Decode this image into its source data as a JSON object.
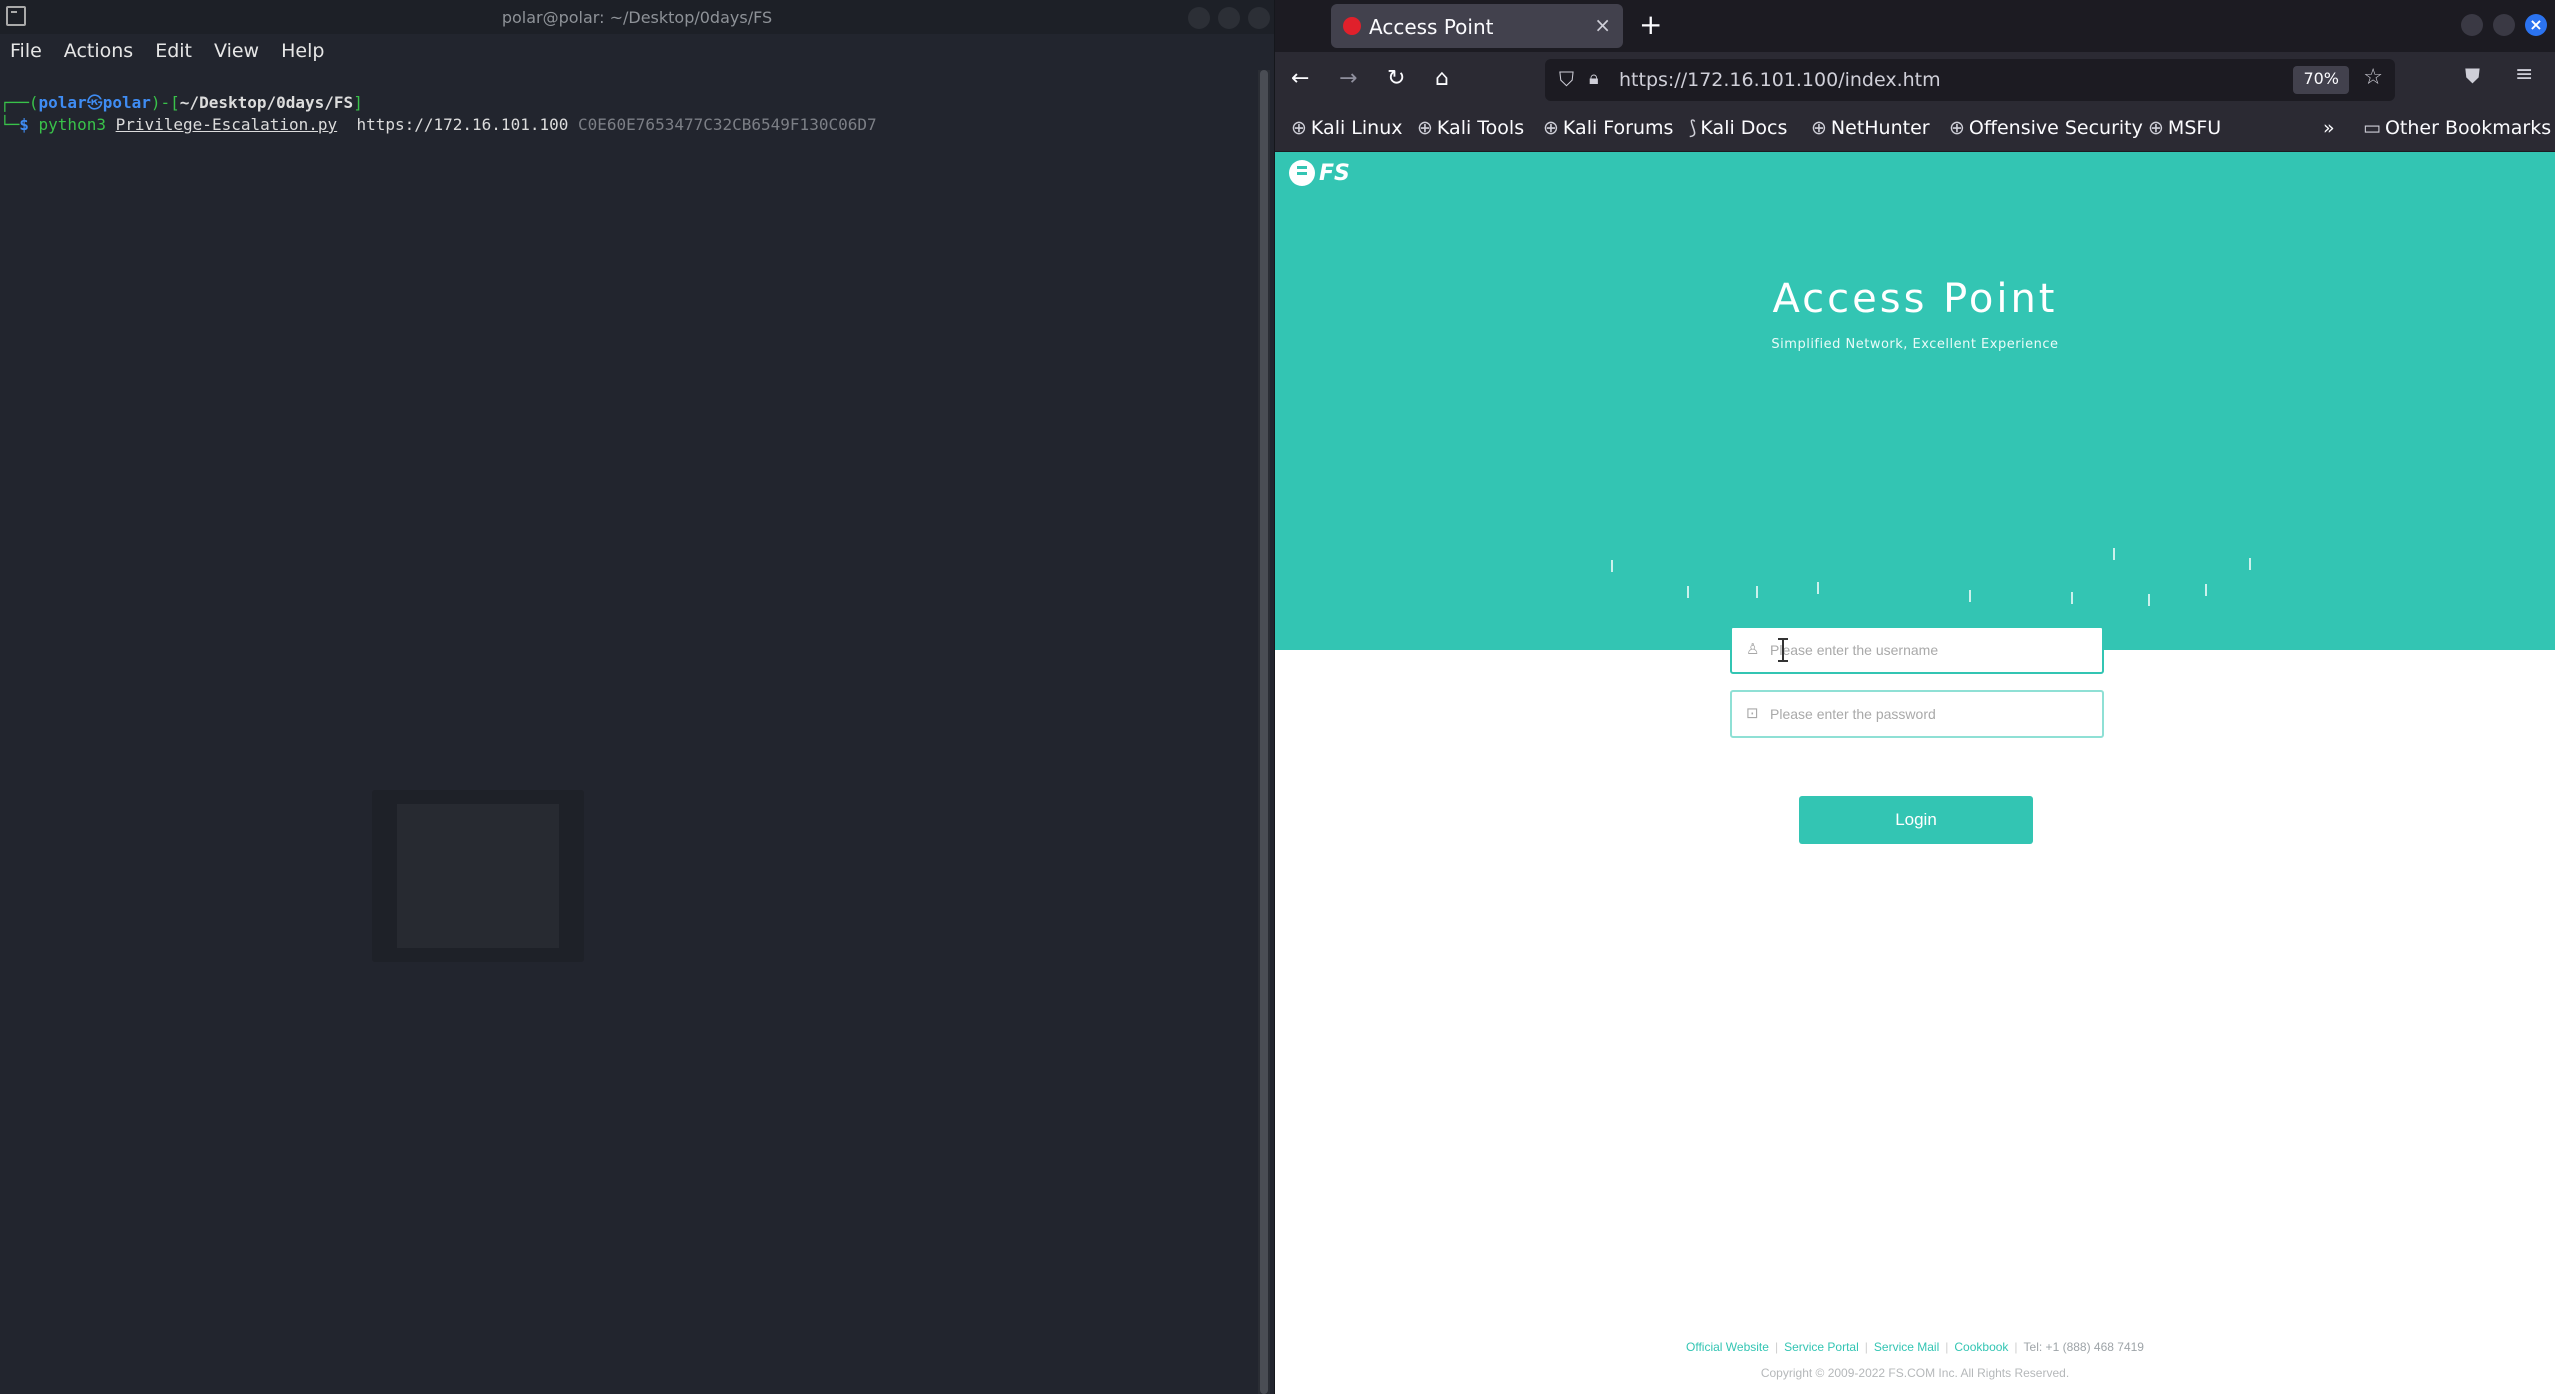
{
  "terminal": {
    "title": "polar@polar: ~/Desktop/0days/FS",
    "menu": [
      "File",
      "Actions",
      "Edit",
      "View",
      "Help"
    ],
    "prompt": {
      "corner_top": "┌──(",
      "user": "polar",
      "at": "㉿",
      "host": "polar",
      "mid": ")-[",
      "path": "~/Desktop/0days/FS",
      "end": "]",
      "corner_bottom": "└─",
      "dollar": "$ "
    },
    "command": {
      "program": "python3",
      "script": "Privilege-Escalation.py",
      "url": "https://172.16.101.100",
      "arg": "C0E60E7653477C32CB6549F130C06D7"
    }
  },
  "browser": {
    "tab": {
      "title": "Access Point",
      "close": "×"
    },
    "new_tab": "+",
    "url": "https://172.16.101.100/index.htm",
    "zoom": "70%",
    "bookmarks": [
      "Kali Linux",
      "Kali Tools",
      "Kali Forums",
      "Kali Docs",
      "NetHunter",
      "Offensive Security",
      "MSFU"
    ],
    "overflow": "»",
    "other_bookmarks": "Other Bookmarks"
  },
  "page": {
    "logo_text": "FS",
    "title": "Access Point",
    "subtitle": "Simplified Network, Excellent Experience",
    "username_placeholder": "Please enter the username",
    "password_placeholder": "Please enter the password",
    "login_label": "Login",
    "footer": {
      "links": [
        "Official Website",
        "Service Portal",
        "Service Mail",
        "Cookbook"
      ],
      "tel": "Tel: +1 (888) 468 7419",
      "copyright": "Copyright © 2009-2022 FS.COM Inc. All Rights Reserved."
    }
  },
  "colors": {
    "accent": "#33c5b3",
    "terminal_bg": "#22252e",
    "browser_chrome": "#2b2a33"
  }
}
